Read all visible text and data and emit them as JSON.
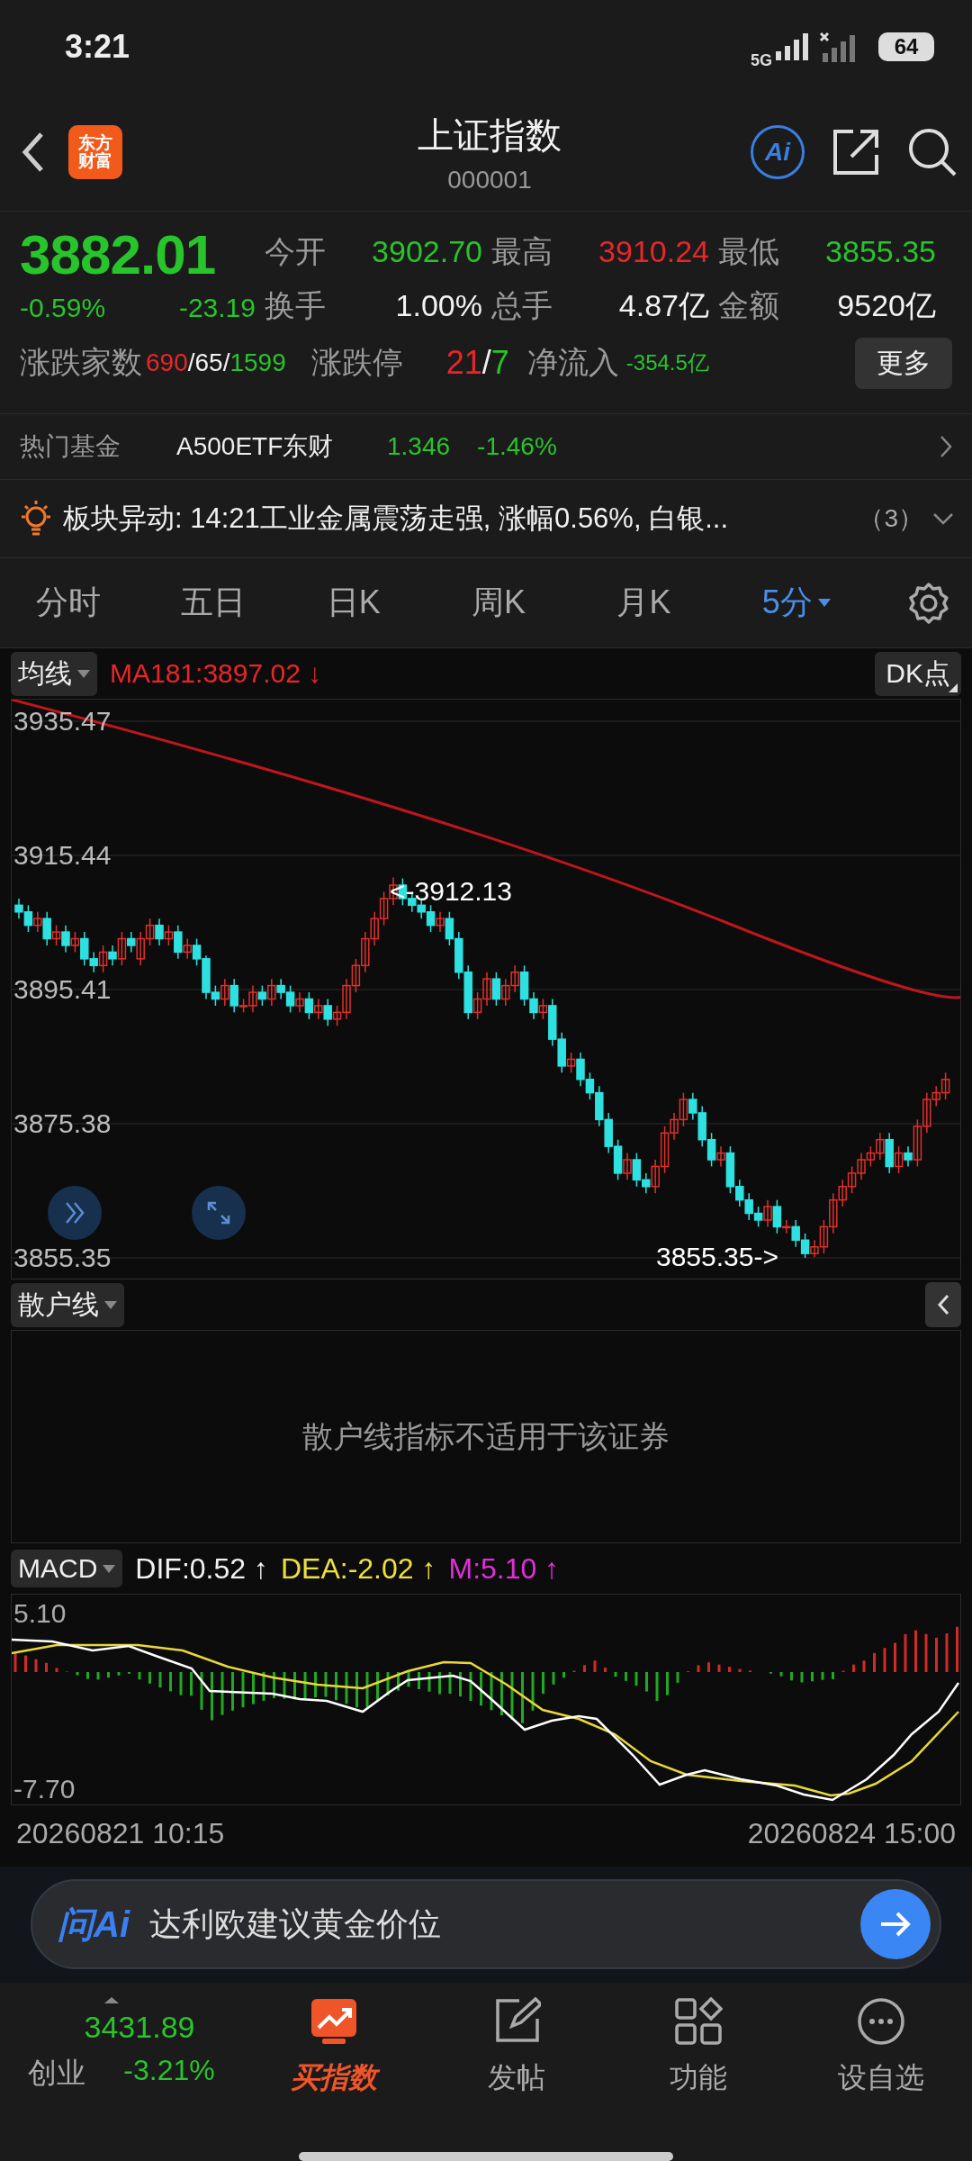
{
  "status_bar": {
    "time": "3:21",
    "network": "5G",
    "battery": "64"
  },
  "header": {
    "logo_lines": [
      "东方",
      "财富"
    ],
    "title": "上证指数",
    "code": "000001",
    "ai_badge": "Ai"
  },
  "quote": {
    "price": "3882.01",
    "change_pct": "-0.59%",
    "change": "-23.19",
    "stats": [
      {
        "label": "今开",
        "value": "3902.70",
        "color": "#28c42c"
      },
      {
        "label": "最高",
        "value": "3910.24",
        "color": "#e8262a"
      },
      {
        "label": "最低",
        "value": "3855.35",
        "color": "#28c42c"
      },
      {
        "label": "换手",
        "value": "1.00%",
        "color": "#f2f2f2"
      },
      {
        "label": "总手",
        "value": "4.87亿",
        "color": "#f2f2f2"
      },
      {
        "label": "金额",
        "value": "9520亿",
        "color": "#f2f2f2"
      }
    ],
    "breadth": {
      "label": "涨跌家数",
      "parts": [
        {
          "text": "690",
          "color": "#e8262a"
        },
        {
          "text": "/65/",
          "color": "#f2f2f2"
        },
        {
          "text": "1599",
          "color": "#28c42c"
        }
      ]
    },
    "limits": {
      "label": "涨跌停",
      "parts": [
        {
          "text": "21",
          "color": "#e8262a"
        },
        {
          "text": "/",
          "color": "#f2f2f2"
        },
        {
          "text": "7",
          "color": "#28c42c"
        }
      ]
    },
    "net_inflow": {
      "label": "净流入",
      "value": "-354.5亿"
    },
    "more_button": "更多"
  },
  "hot_fund": {
    "label": "热门基金",
    "name": "A500ETF东财",
    "price": "1.346",
    "change": "-1.46%"
  },
  "alert": {
    "text": "板块异动: 14:21工业金属震荡走强, 涨幅0.56%, 白银...",
    "count": "（3）"
  },
  "period_tabs": [
    {
      "label": "分时",
      "selected": false,
      "has_dropdown": false
    },
    {
      "label": "五日",
      "selected": false,
      "has_dropdown": false
    },
    {
      "label": "日K",
      "selected": false,
      "has_dropdown": false
    },
    {
      "label": "周K",
      "selected": false,
      "has_dropdown": false
    },
    {
      "label": "月K",
      "selected": false,
      "has_dropdown": false
    },
    {
      "label": "5分",
      "selected": true,
      "has_dropdown": true
    }
  ],
  "main_chart": {
    "indicator": "均线",
    "ma_label": "MA181:3897.02",
    "ma_arrow": "↓",
    "dk_button": "DK点",
    "high_marker": "<-3912.13",
    "low_marker": "3855.35->",
    "chart_data": {
      "type": "candlestick",
      "grid": true,
      "ylim": [
        3855.35,
        3935.47
      ],
      "yticks": [
        3935.47,
        3915.44,
        3895.41,
        3875.38,
        3855.35
      ],
      "ohlc": [
        [
          3908,
          3909,
          3906,
          3907
        ],
        [
          3907,
          3908,
          3904,
          3905
        ],
        [
          3905,
          3907,
          3904,
          3906
        ],
        [
          3906,
          3907,
          3902,
          3903
        ],
        [
          3903,
          3905,
          3902,
          3904
        ],
        [
          3904,
          3905,
          3901,
          3902
        ],
        [
          3902,
          3904,
          3901,
          3903
        ],
        [
          3903,
          3904,
          3899,
          3900
        ],
        [
          3900,
          3901,
          3898,
          3899
        ],
        [
          3899,
          3902,
          3898,
          3901
        ],
        [
          3901,
          3902,
          3899,
          3900
        ],
        [
          3900,
          3904,
          3899,
          3903
        ],
        [
          3903,
          3904,
          3901,
          3902
        ],
        [
          3900,
          3904,
          3899,
          3903
        ],
        [
          3903,
          3906,
          3902,
          3905
        ],
        [
          3905,
          3906,
          3902,
          3903
        ],
        [
          3903,
          3905,
          3902,
          3904
        ],
        [
          3904,
          3905,
          3900,
          3901
        ],
        [
          3901,
          3903,
          3900,
          3902
        ],
        [
          3902,
          3903,
          3899,
          3900
        ],
        [
          3900,
          3900.5,
          3894,
          3895
        ],
        [
          3895,
          3896,
          3893,
          3894
        ],
        [
          3894,
          3897,
          3893,
          3896
        ],
        [
          3896,
          3897,
          3892,
          3893
        ],
        [
          3893,
          3894,
          3892,
          3893
        ],
        [
          3893,
          3896,
          3892,
          3895
        ],
        [
          3895,
          3896,
          3893,
          3894
        ],
        [
          3894,
          3897,
          3893,
          3896
        ],
        [
          3896,
          3897,
          3894,
          3895
        ],
        [
          3895,
          3896,
          3892,
          3893
        ],
        [
          3893,
          3895,
          3892,
          3894
        ],
        [
          3894,
          3895,
          3891,
          3892
        ],
        [
          3892,
          3894,
          3891,
          3893
        ],
        [
          3893,
          3894,
          3890,
          3891
        ],
        [
          3891,
          3893,
          3890,
          3892
        ],
        [
          3892,
          3897,
          3891,
          3896
        ],
        [
          3896,
          3900,
          3895,
          3899
        ],
        [
          3899,
          3904,
          3898,
          3903
        ],
        [
          3903,
          3907,
          3902,
          3906
        ],
        [
          3906,
          3910,
          3905,
          3909
        ],
        [
          3909,
          3912.13,
          3908,
          3911
        ],
        [
          3911,
          3912,
          3908,
          3909
        ],
        [
          3909,
          3910,
          3907,
          3908
        ],
        [
          3908,
          3909,
          3906,
          3907
        ],
        [
          3907,
          3908,
          3904,
          3905
        ],
        [
          3905,
          3907,
          3904,
          3906
        ],
        [
          3906,
          3907,
          3902,
          3903
        ],
        [
          3903,
          3904,
          3897,
          3898
        ],
        [
          3898,
          3899,
          3891,
          3892
        ],
        [
          3892,
          3895,
          3891,
          3894
        ],
        [
          3894,
          3898,
          3893,
          3897
        ],
        [
          3897,
          3898,
          3893,
          3894
        ],
        [
          3894,
          3897,
          3893,
          3896
        ],
        [
          3896,
          3899,
          3895,
          3898
        ],
        [
          3898,
          3899,
          3893,
          3894
        ],
        [
          3894,
          3895,
          3891,
          3892
        ],
        [
          3892,
          3894,
          3891,
          3893
        ],
        [
          3893,
          3894,
          3887,
          3888
        ],
        [
          3888,
          3889,
          3883,
          3884
        ],
        [
          3884,
          3886,
          3883,
          3885
        ],
        [
          3885,
          3886,
          3881,
          3882
        ],
        [
          3882,
          3883,
          3879,
          3880
        ],
        [
          3880,
          3881,
          3875,
          3876
        ],
        [
          3876,
          3877,
          3871,
          3872
        ],
        [
          3872,
          3873,
          3867,
          3868
        ],
        [
          3868,
          3871,
          3867,
          3870
        ],
        [
          3870,
          3871,
          3866,
          3867
        ],
        [
          3867,
          3868,
          3865,
          3866
        ],
        [
          3866,
          3870,
          3865,
          3869
        ],
        [
          3869,
          3875,
          3868,
          3874
        ],
        [
          3874,
          3877,
          3873,
          3876
        ],
        [
          3876,
          3880,
          3875,
          3879
        ],
        [
          3879,
          3880,
          3876,
          3877
        ],
        [
          3877,
          3878,
          3872,
          3873
        ],
        [
          3873,
          3874,
          3869,
          3870
        ],
        [
          3870,
          3872,
          3869,
          3871
        ],
        [
          3871,
          3872,
          3865,
          3866
        ],
        [
          3866,
          3867,
          3863,
          3864
        ],
        [
          3864,
          3865,
          3861,
          3862
        ],
        [
          3862,
          3863,
          3860,
          3861
        ],
        [
          3861,
          3864,
          3860,
          3863
        ],
        [
          3863,
          3864,
          3859,
          3860
        ],
        [
          3860,
          3861,
          3859,
          3860
        ],
        [
          3860,
          3861,
          3857,
          3858
        ],
        [
          3858,
          3859,
          3855.35,
          3856
        ],
        [
          3856,
          3858,
          3855.5,
          3857
        ],
        [
          3857,
          3861,
          3856,
          3860
        ],
        [
          3860,
          3865,
          3859,
          3864
        ],
        [
          3864,
          3867,
          3863,
          3866
        ],
        [
          3866,
          3869,
          3865,
          3868
        ],
        [
          3868,
          3871,
          3867,
          3870
        ],
        [
          3870,
          3872,
          3869,
          3871
        ],
        [
          3871,
          3874,
          3870,
          3873
        ],
        [
          3873,
          3874,
          3868,
          3869
        ],
        [
          3869,
          3872,
          3868,
          3871
        ],
        [
          3871,
          3872,
          3869,
          3870
        ],
        [
          3870,
          3876,
          3869,
          3875
        ],
        [
          3875,
          3880,
          3874,
          3879
        ],
        [
          3879,
          3881,
          3878,
          3880
        ],
        [
          3880,
          3883,
          3879,
          3882
        ]
      ]
    }
  },
  "retail_panel": {
    "indicator": "散户线",
    "message": "散户线指标不适用于该证券"
  },
  "macd": {
    "indicator": "MACD",
    "dif": "DIF:0.52",
    "dif_arrow": "↑",
    "dea": "DEA:-2.02",
    "dea_arrow": "↑",
    "m": "M:5.10",
    "m_arrow": "↑",
    "y_labels": [
      "5.10",
      "-7.70"
    ]
  },
  "time_range": {
    "start": "20260821 10:15",
    "end": "20260824 15:00"
  },
  "ask_ai": {
    "brand": "问Ai",
    "prompt": "达利欧建议黄金价位"
  },
  "bottom_nav": {
    "index": {
      "value": "3431.89",
      "name": "创业",
      "change": "-3.21%"
    },
    "items": [
      {
        "label": "买指数",
        "kind": "promo"
      },
      {
        "label": "发帖",
        "kind": "post"
      },
      {
        "label": "功能",
        "kind": "apps"
      },
      {
        "label": "设自选",
        "kind": "more"
      }
    ]
  }
}
